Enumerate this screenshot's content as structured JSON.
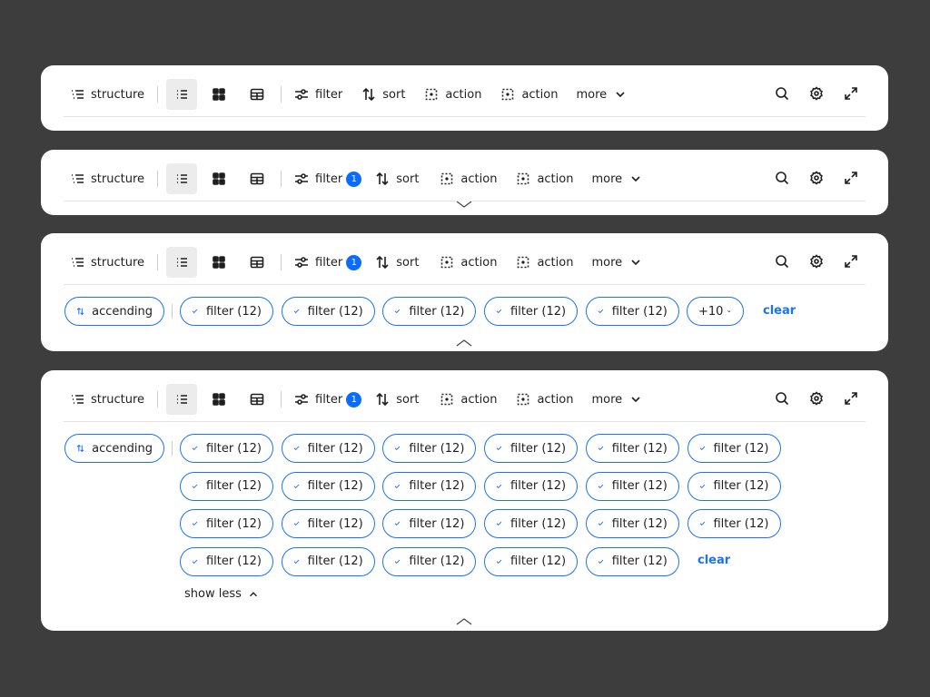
{
  "toolbar": {
    "structure": "structure",
    "filter": "filter",
    "filter_badge": "1",
    "sort": "sort",
    "actions": [
      "action",
      "action"
    ],
    "more": "more"
  },
  "chips": {
    "sort_chip": "accending",
    "filter_chip": "filter (12)",
    "overflow": "+10",
    "clear": "clear",
    "show_less": "show less"
  },
  "colors": {
    "accent": "#1a73f0",
    "badge": "#0a6cff",
    "background": "#3d3d3d"
  }
}
